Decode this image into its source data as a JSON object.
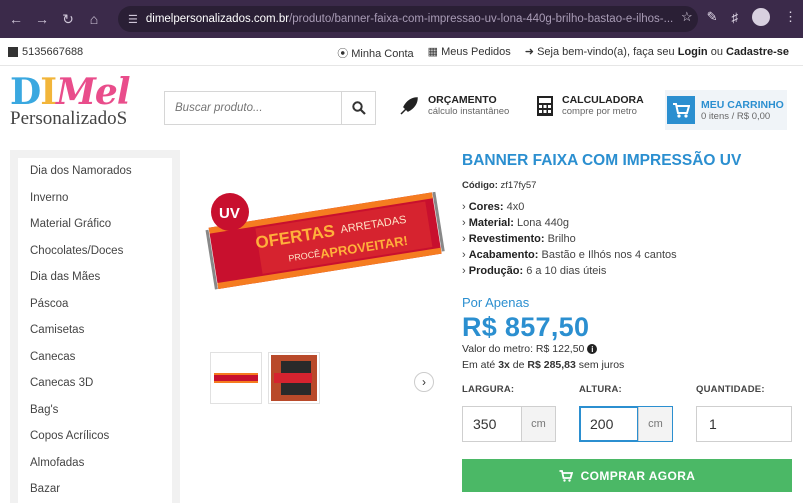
{
  "browser": {
    "url_domain": "dimelpersonalizados.com.br",
    "url_path": "/produto/banner-faixa-com-impressao-uv-lona-440g-brilho-bastao-e-ilhos-..."
  },
  "topbar": {
    "phone": "5135667688",
    "account": "Minha Conta",
    "orders": "Meus Pedidos",
    "welcome_prefix": "Seja bem-vindo(a), faça seu ",
    "login": "Login",
    "or": " ou ",
    "register": "Cadastre-se"
  },
  "header": {
    "logo_top": "DIMel",
    "logo_bottom": "PersonalizadoS",
    "search_placeholder": "Buscar produto...",
    "quote_title": "ORÇAMENTO",
    "quote_sub": "cálculo instantâneo",
    "calc_title": "CALCULADORA",
    "calc_sub": "compre por metro",
    "cart_title": "MEU CARRINHO",
    "cart_sub": "0 itens / R$ 0,00"
  },
  "sidebar": {
    "items": [
      "Dia dos Namorados",
      "Inverno",
      "Material Gráfico",
      "Chocolates/Doces",
      "Dia das Mães",
      "Páscoa",
      "Camisetas",
      "Canecas",
      "Canecas 3D",
      "Bag's",
      "Copos Acrílicos",
      "Almofadas",
      "Bazar"
    ]
  },
  "product": {
    "banner_badge": "UV",
    "banner_line1a": "OFERTAS",
    "banner_line1b": "ARRETADAS",
    "banner_line2a": "PROCÊ",
    "banner_line2b": "APROVEITAR!",
    "title": "BANNER FAIXA COM IMPRESSÃO UV",
    "code_label": "Código:",
    "code_value": "zf17fy57",
    "specs": [
      {
        "label": "Cores:",
        "value": "4x0"
      },
      {
        "label": "Material:",
        "value": "Lona 440g"
      },
      {
        "label": "Revestimento:",
        "value": "Brilho"
      },
      {
        "label": "Acabamento:",
        "value": "Bastão e Ilhós nos 4 cantos"
      },
      {
        "label": "Produção:",
        "value": "6 a 10 dias úteis"
      }
    ],
    "price_prefix": "Por Apenas",
    "price": "R$ 857,50",
    "meter_price": "Valor do metro: R$ 122,50",
    "installment_prefix": "Em até ",
    "installment_count": "3x",
    "installment_mid": " de ",
    "installment_value": "R$ 285,83",
    "installment_suffix": " sem juros"
  },
  "dims": {
    "width_label": "LARGURA:",
    "width_value": "350",
    "height_label": "ALTURA:",
    "height_value": "200",
    "unit": "cm",
    "qty_label": "QUANTIDADE:",
    "qty_value": "1"
  },
  "buy_label": "COMPRAR AGORA",
  "colors": {
    "accent": "#2b8fd0",
    "buy": "#4bb866",
    "banner_red": "#c8102e",
    "banner_orange": "#f57c20"
  }
}
